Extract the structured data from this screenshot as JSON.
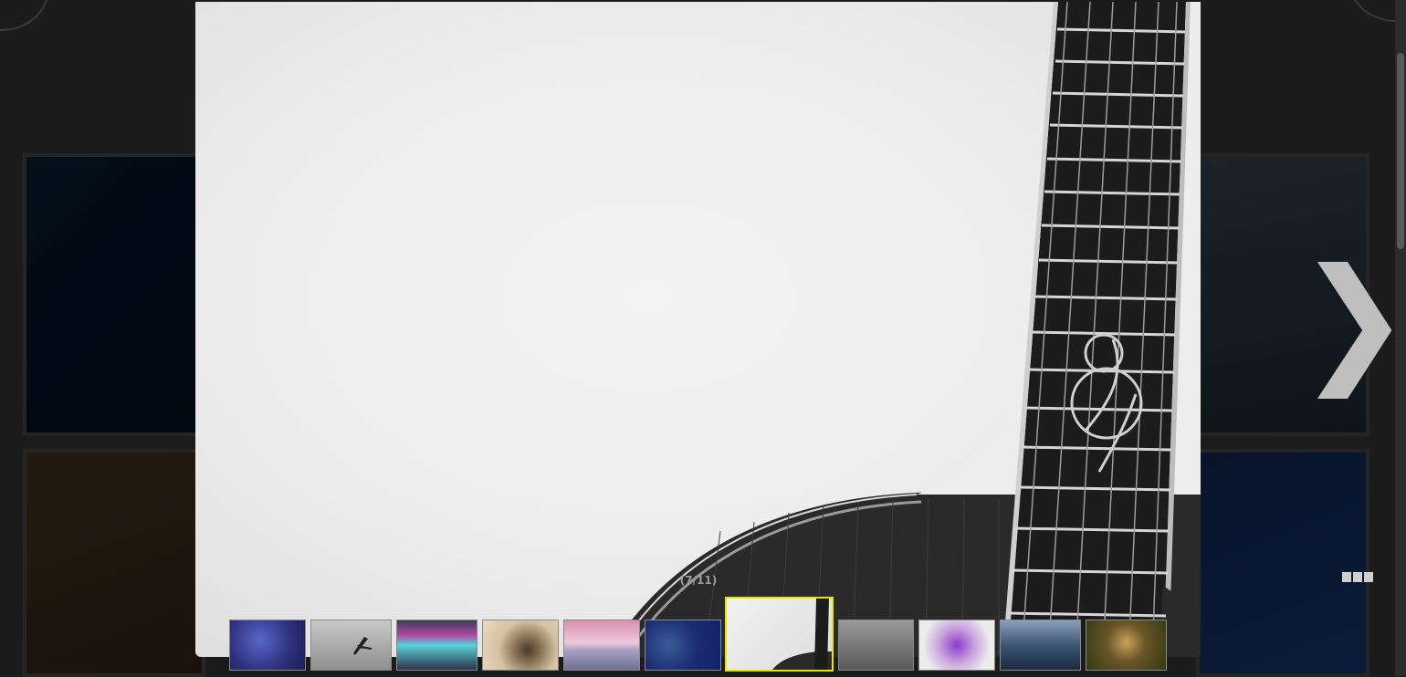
{
  "viewer": {
    "counter_text": "(7/11)",
    "next_icon": "❯",
    "current_index": 7,
    "total": 11
  },
  "thumbnails": [
    {
      "name": "thumb-1-blue-lights"
    },
    {
      "name": "thumb-2-gray-plane"
    },
    {
      "name": "thumb-3-neon-shore"
    },
    {
      "name": "thumb-4-spiral-shell"
    },
    {
      "name": "thumb-5-pink-skyline"
    },
    {
      "name": "thumb-6-blue-bubbles"
    },
    {
      "name": "thumb-7-guitar",
      "active": true
    },
    {
      "name": "thumb-8-gray-water"
    },
    {
      "name": "thumb-9-purple-flowers"
    },
    {
      "name": "thumb-10-stormy-sea"
    },
    {
      "name": "thumb-11-mushrooms"
    }
  ],
  "colors": {
    "active_border": "#e6e600",
    "backdrop": "#1c1c1c"
  }
}
